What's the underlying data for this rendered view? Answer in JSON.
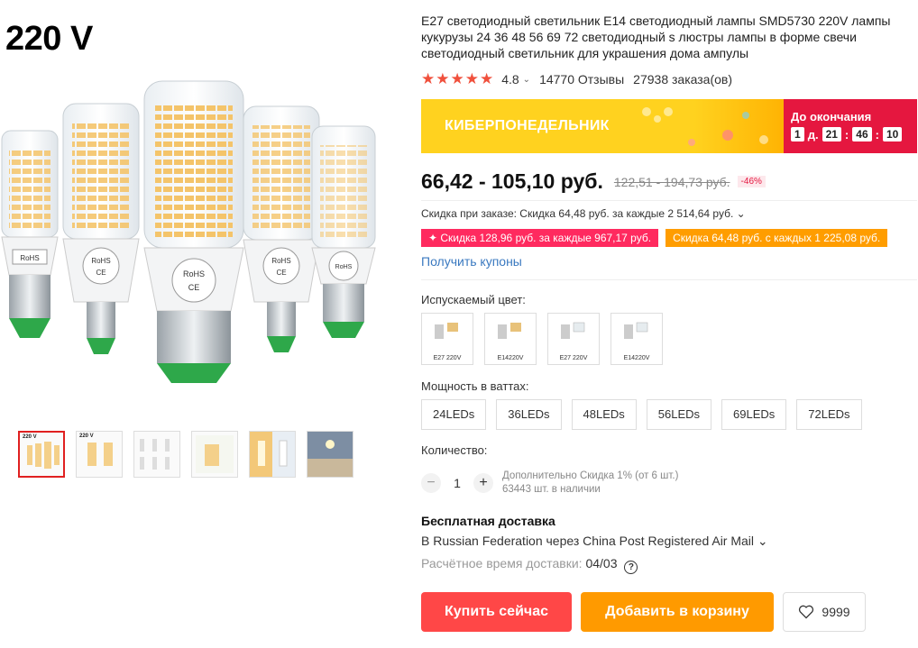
{
  "gallery": {
    "main_label": "220 V",
    "bulb_labels": {
      "rohs": "RoHS",
      "ce": "CE"
    },
    "thumbs": [
      {
        "label": "220 V",
        "active": true
      },
      {
        "label": "220 V",
        "active": false
      },
      {
        "label": "",
        "active": false
      },
      {
        "label": "",
        "active": false
      },
      {
        "label": "",
        "active": false
      },
      {
        "label": "",
        "active": false
      }
    ]
  },
  "product": {
    "title": "E27 светодиодный светильник E14 светодиодный лампы SMD5730 220V лампы кукурузы 24 36 48 56 69 72 светодиодный s люстры лампы в форме свечи светодиодный светильник для украшения дома ампулы",
    "rating": "4.8",
    "reviews": "14770 Отзывы",
    "orders": "27938 заказа(ов)"
  },
  "banner": {
    "text": "КИБЕРПОНЕДЕЛЬНИК",
    "until": "До окончания",
    "days": "1",
    "days_unit": "д.",
    "hours": "21",
    "minutes": "46",
    "seconds": "10"
  },
  "price": {
    "current": "66,42 - 105,10 руб.",
    "old": "122,51 - 194,73 руб.",
    "discount": "-46%"
  },
  "sale": {
    "line": "Скидка при заказе: Скидка 64,48 руб. за каждые 2 514,64 руб. ⌄",
    "coupon1": "✦ Скидка 128,96 руб. за каждые 967,17 руб.",
    "coupon2": "Скидка 64,48 руб. с каждых 1 225,08 руб.",
    "get_coupons": "Получить купоны"
  },
  "color": {
    "label": "Испускаемый цвет:",
    "options": [
      {
        "caption": "E27 220V"
      },
      {
        "caption": "E14220V"
      },
      {
        "caption": "E27 220V"
      },
      {
        "caption": "E14220V"
      }
    ]
  },
  "power": {
    "label": "Мощность в ваттах:",
    "options": [
      "24LEDs",
      "36LEDs",
      "48LEDs",
      "56LEDs",
      "69LEDs",
      "72LEDs"
    ]
  },
  "quantity": {
    "label": "Количество:",
    "minus": "−",
    "plus": "+",
    "value": "1",
    "discount_note": "Дополнительно Скидка 1% (от 6 шт.)",
    "stock": "63443 шт. в наличии"
  },
  "shipping": {
    "title": "Бесплатная доставка",
    "line": "В Russian Federation через China Post Registered Air Mail ⌄",
    "time_label": "Расчётное время доставки:",
    "time_value": "04/03",
    "help": "?"
  },
  "actions": {
    "buy": "Купить сейчас",
    "cart": "Добавить в корзину",
    "wish_count": "9999"
  },
  "colors": {
    "accent_red": "#ff4747",
    "accent_orange": "#ff9a00",
    "link": "#3a79c0"
  }
}
